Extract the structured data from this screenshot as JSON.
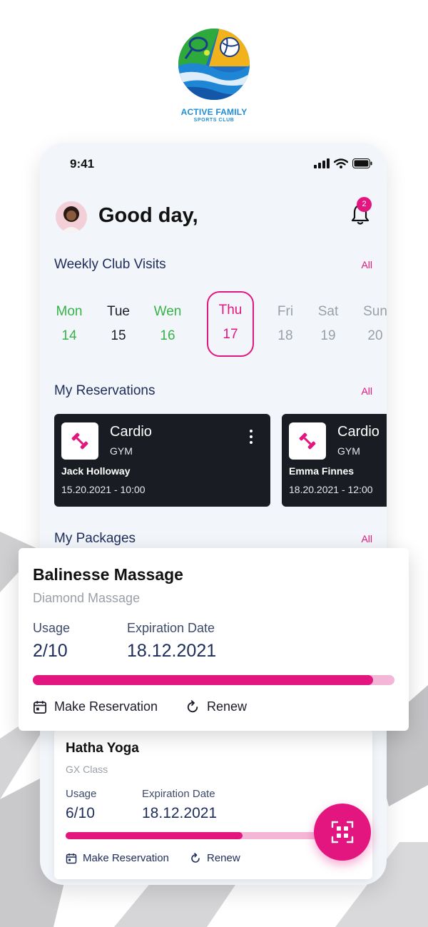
{
  "logo": {
    "name": "ACTIVE FAMILY",
    "sub": "SPORTS CLUB"
  },
  "status_bar": {
    "time": "9:41"
  },
  "header": {
    "greeting": "Good day,",
    "notification_count": "2"
  },
  "weekly": {
    "title": "Weekly Club Visits",
    "all_label": "All",
    "days": [
      {
        "name": "Mon",
        "date": "14",
        "state": "visited"
      },
      {
        "name": "Tue",
        "date": "15",
        "state": "normal"
      },
      {
        "name": "Wen",
        "date": "16",
        "state": "visited"
      },
      {
        "name": "Thu",
        "date": "17",
        "state": "selected"
      },
      {
        "name": "Fri",
        "date": "18",
        "state": "future"
      },
      {
        "name": "Sat",
        "date": "19",
        "state": "future"
      },
      {
        "name": "Sun",
        "date": "20",
        "state": "future"
      }
    ]
  },
  "reservations": {
    "title": "My Reservations",
    "all_label": "All",
    "items": [
      {
        "title": "Cardio",
        "type": "GYM",
        "trainer": "Jack Holloway",
        "datetime": "15.20.2021  -  10:00"
      },
      {
        "title": "Cardio",
        "type": "GYM",
        "trainer": "Emma Finnes",
        "datetime": "18.20.2021  -  12:00"
      }
    ]
  },
  "packages": {
    "title": "My Packages",
    "all_label": "All",
    "featured": {
      "title": "Balinesse Massage",
      "subtitle": "Diamond Massage",
      "usage_label": "Usage",
      "usage_value": "2/10",
      "usage_progress": 0.94,
      "expiry_label": "Expiration Date",
      "expiry_value": "18.12.2021",
      "reserve_label": "Make Reservation",
      "renew_label": "Renew"
    },
    "second": {
      "title": "Hatha Yoga",
      "subtitle": "GX Class",
      "usage_label": "Usage",
      "usage_value": "6/10",
      "usage_progress": 0.6,
      "expiry_label": "Expiration Date",
      "expiry_value": "18.12.2021",
      "reserve_label": "Make Reservation",
      "renew_label": "Renew"
    }
  },
  "colors": {
    "accent": "#e3157f",
    "visited": "#37b34a",
    "navy": "#1d2c5a",
    "card_dark": "#1a1c24"
  },
  "icons": {
    "fab": "qr-scan-icon",
    "reservation": "calendar-icon",
    "renew": "refresh-icon",
    "notifications": "bell-icon",
    "activity": "dumbbell-icon"
  }
}
